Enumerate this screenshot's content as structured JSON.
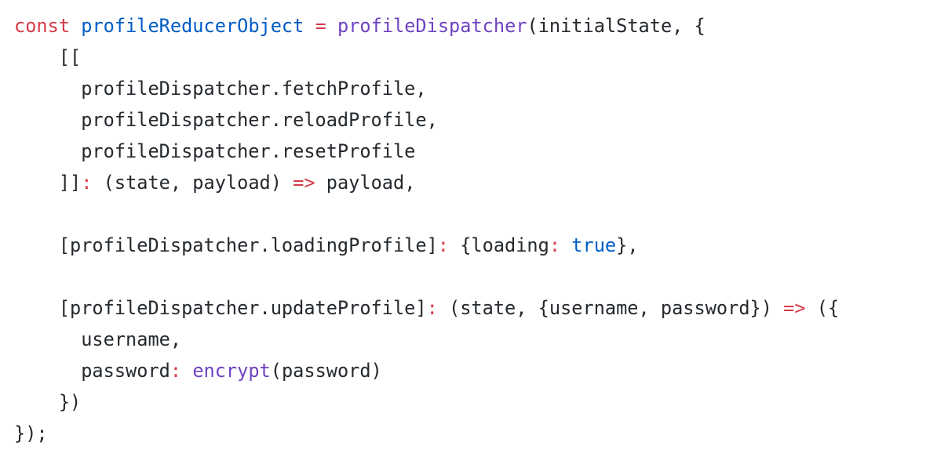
{
  "colors": {
    "keyword": "#d73a49",
    "variable": "#005cc5",
    "function": "#6f42c1",
    "text": "#24292e"
  },
  "code_lines": [
    [
      {
        "t": "const",
        "c": "kw"
      },
      {
        "t": " "
      },
      {
        "t": "profileReducerObject",
        "c": "var"
      },
      {
        "t": " "
      },
      {
        "t": "=",
        "c": "op"
      },
      {
        "t": " "
      },
      {
        "t": "profileDispatcher",
        "c": "fn"
      },
      {
        "t": "(initialState, {"
      }
    ],
    [
      {
        "t": "    [["
      }
    ],
    [
      {
        "t": "      profileDispatcher.fetchProfile,"
      }
    ],
    [
      {
        "t": "      profileDispatcher.reloadProfile,"
      }
    ],
    [
      {
        "t": "      profileDispatcher.resetProfile"
      }
    ],
    [
      {
        "t": "    ]]"
      },
      {
        "t": ":",
        "c": "op"
      },
      {
        "t": " (state, payload) "
      },
      {
        "t": "=>",
        "c": "op"
      },
      {
        "t": " payload,"
      }
    ],
    [],
    [
      {
        "t": "    [profileDispatcher.loadingProfile]"
      },
      {
        "t": ":",
        "c": "op"
      },
      {
        "t": " {loading"
      },
      {
        "t": ":",
        "c": "op"
      },
      {
        "t": " "
      },
      {
        "t": "true",
        "c": "lit"
      },
      {
        "t": "},"
      }
    ],
    [],
    [
      {
        "t": "    [profileDispatcher.updateProfile]"
      },
      {
        "t": ":",
        "c": "op"
      },
      {
        "t": " (state, {username, password}) "
      },
      {
        "t": "=>",
        "c": "op"
      },
      {
        "t": " ({"
      }
    ],
    [
      {
        "t": "      username,"
      }
    ],
    [
      {
        "t": "      password"
      },
      {
        "t": ":",
        "c": "op"
      },
      {
        "t": " "
      },
      {
        "t": "encrypt",
        "c": "fn"
      },
      {
        "t": "(password)"
      }
    ],
    [
      {
        "t": "    })"
      }
    ],
    [
      {
        "t": "});"
      }
    ]
  ]
}
